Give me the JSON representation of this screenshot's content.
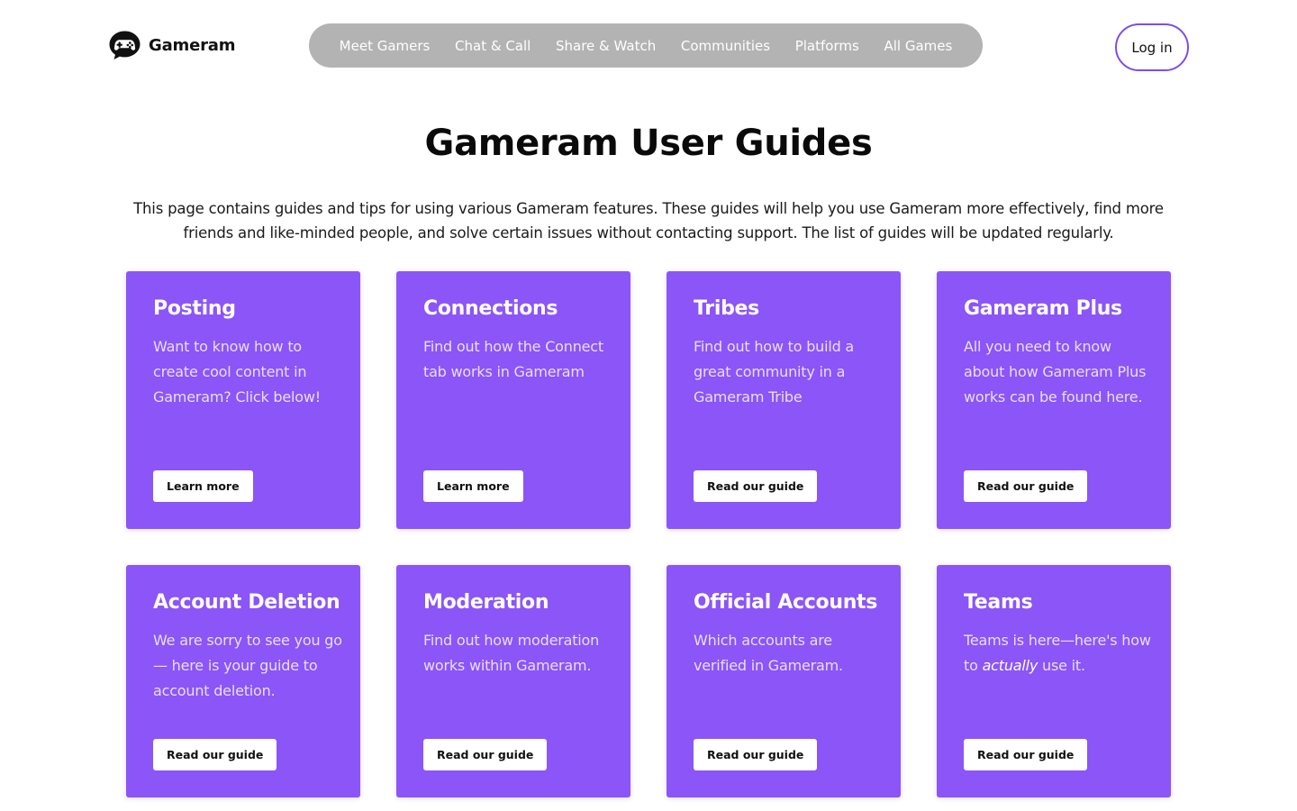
{
  "header": {
    "logo_text": "Gameram",
    "nav": [
      "Meet Gamers",
      "Chat & Call",
      "Share & Watch",
      "Communities",
      "Platforms",
      "All Games"
    ],
    "login_label": "Log in"
  },
  "colors": {
    "accent": "#8b55f7",
    "nav_background": "#b3b3b3",
    "login_border": "#7c4dee"
  },
  "page": {
    "title": "Gameram User Guides",
    "intro": "This page contains guides and tips for using various Gameram features. These guides will help you use Gameram more effectively, find more friends and like-minded people, and solve certain issues without contacting support. The list of guides will be updated regularly."
  },
  "guides": [
    {
      "title": "Posting",
      "desc": "Want to know how to create cool content in Gameram? Click below!",
      "button": "Learn more"
    },
    {
      "title": "Connections",
      "desc": "Find out how the Connect tab works in Gameram",
      "button": "Learn more"
    },
    {
      "title": "Tribes",
      "desc": "Find out how to build a great community in a Gameram Tribe",
      "button": "Read our guide"
    },
    {
      "title": "Gameram Plus",
      "desc": "All you need to know about how Gameram Plus works can be found here.",
      "button": "Read our guide"
    },
    {
      "title": "Account Deletion",
      "desc": "We are sorry to see you go — here is your guide to account deletion.",
      "button": "Read our guide"
    },
    {
      "title": "Moderation",
      "desc": "Find out how moderation works within Gameram.",
      "button": "Read our guide"
    },
    {
      "title": "Official Accounts",
      "desc": "Which accounts are verified in Gameram.",
      "button": "Read our guide"
    },
    {
      "title": "Teams",
      "desc_before": "Teams is here—here's how to ",
      "desc_em": "actually",
      "desc_after": " use it.",
      "button": "Read our guide"
    }
  ]
}
